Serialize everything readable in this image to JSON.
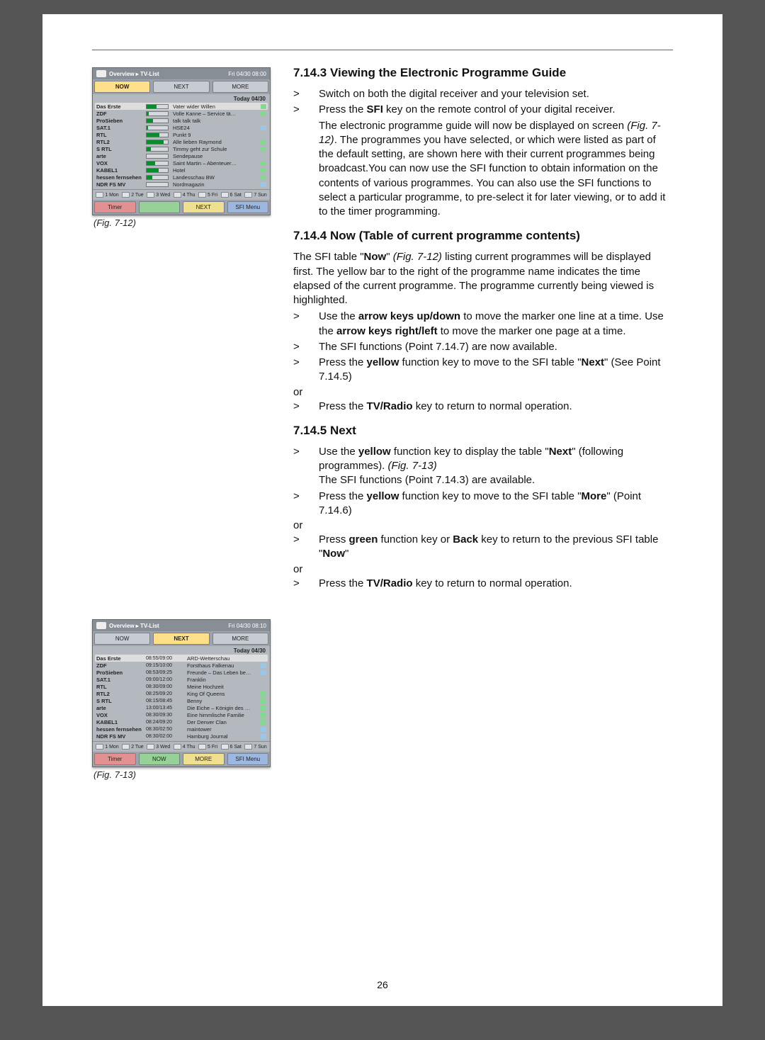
{
  "page_number": "26",
  "sections": {
    "s7143": {
      "heading": "7.14.3 Viewing the Electronic Programme Guide",
      "p1": "Switch on both the digital receiver and your television set.",
      "p2a": "Press the ",
      "p2b": "SFI",
      "p2c": " key on the remote control of your digital receiver.",
      "p3a": "The electronic programme guide will now be displayed on screen ",
      "p3b": "(Fig. 7-12)",
      "p3c": ". The programmes you have selected, or which were listed as part of the default setting, are shown here with their current programmes being broadcast.You can now use the SFI function to obtain information on the contents of various programmes. You can also use the SFI functions to select a particular programme, to pre-select it for later viewing, or to add it to the timer programming."
    },
    "s7144": {
      "heading": "7.14.4 Now (Table of current programme contents)",
      "p1a": "The SFI table \"",
      "p1b": "Now",
      "p1c": "\" ",
      "p1d": "(Fig. 7-12)",
      "p1e": " listing current programmes will be displayed first. The yellow bar to the right of the programme name indicates the time elapsed of the current programme. The programme currently being viewed is highlighted.",
      "b1a": "Use the ",
      "b1b": "arrow keys up/down",
      "b1c": " to move the marker one line at a time. Use the ",
      "b1d": "arrow keys right/left",
      "b1e": " to move the marker one page at a time.",
      "b2": "The SFI functions (Point 7.14.7) are now available.",
      "b3a": "Press the ",
      "b3b": "yellow",
      "b3c": " function key to move to the SFI table \"",
      "b3d": "Next",
      "b3e": "\" (See Point 7.14.5)",
      "or": "or",
      "b4a": "Press the ",
      "b4b": "TV/Radio",
      "b4c": " key to return to normal operation."
    },
    "s7145": {
      "heading": "7.14.5 Next",
      "b1a": "Use the ",
      "b1b": "yellow",
      "b1c": " function key to display the table \"",
      "b1d": "Next",
      "b1e": "\" (following programmes). ",
      "b1f": "(Fig. 7-13)",
      "b1g": "The SFI functions (Point 7.14.3) are available.",
      "b2a": "Press the ",
      "b2b": "yellow",
      "b2c": " function key to move to the SFI table \"",
      "b2d": "More",
      "b2e": "\" (Point 7.14.6)",
      "or": "or",
      "b3a": "Press ",
      "b3b": "green",
      "b3c": " function key or ",
      "b3d": "Back",
      "b3e": " key to return to the previous SFI table \"",
      "b3f": "Now",
      "b3g": "\"",
      "b4a": "Press the ",
      "b4b": "TV/Radio",
      "b4c": " key to return to normal operation."
    }
  },
  "marker": ">",
  "fig12": {
    "caption": "(Fig. 7-12)",
    "breadcrumb": "Overview ▸ TV-List",
    "datetime": "Fri 04/30   08:00",
    "tabs": [
      "NOW",
      "NEXT",
      "MORE"
    ],
    "active_tab": 0,
    "date_label": "Today 04/30",
    "days": [
      "1 Mon",
      "2 Tue",
      "3 Wed",
      "4 Thu",
      "5 Fri",
      "6 Sat",
      "7 Sun"
    ],
    "footer_tabs": [
      "Timer",
      "",
      "NEXT",
      "SFI Menu"
    ],
    "rows": [
      {
        "ch": "Das Erste",
        "fill": 45,
        "prog": "Vater wider Willen",
        "tag": "film",
        "sel": true
      },
      {
        "ch": "ZDF",
        "fill": 10,
        "prog": "Volle Kanne – Service tä…",
        "tag": "film"
      },
      {
        "ch": "ProSieben",
        "fill": 30,
        "prog": "talk talk talk"
      },
      {
        "ch": "SAT.1",
        "fill": 5,
        "prog": "HSE24",
        "tag": "doc"
      },
      {
        "ch": "RTL",
        "fill": 60,
        "prog": "Punkt 9"
      },
      {
        "ch": "RTL2",
        "fill": 80,
        "prog": "Alle lieben Raymond",
        "tag": "film"
      },
      {
        "ch": "S RTL",
        "fill": 20,
        "prog": "Timmy geht zur Schule",
        "tag": "film"
      },
      {
        "ch": "arte",
        "fill": 0,
        "prog": "Sendepause"
      },
      {
        "ch": "VOX",
        "fill": 40,
        "prog": "Saint Martin – Abenteuer…",
        "tag": "film"
      },
      {
        "ch": "KABEL1",
        "fill": 55,
        "prog": "Hotel",
        "tag": "film"
      },
      {
        "ch": "hessen fernsehen",
        "fill": 25,
        "prog": "Landesschau BW",
        "tag": "film"
      },
      {
        "ch": "NDR FS MV",
        "fill": 0,
        "prog": "Nordmagazin",
        "tag": "doc"
      }
    ]
  },
  "fig13": {
    "caption": "(Fig. 7-13)",
    "breadcrumb": "Overview ▸ TV-List",
    "datetime": "Fri 04/30   08:10",
    "tabs": [
      "NOW",
      "NEXT",
      "MORE"
    ],
    "active_tab": 1,
    "date_label": "Today 04/30",
    "days": [
      "1 Mon",
      "2 Tue",
      "3 Wed",
      "4 Thu",
      "5 Fri",
      "6 Sat",
      "7 Sun"
    ],
    "footer_tabs": [
      "Timer",
      "NOW",
      "MORE",
      "SFI Menu"
    ],
    "rows": [
      {
        "ch": "Das Erste",
        "time": "08:55/09:00",
        "prog": "ARD-Wetterschau",
        "sel": true
      },
      {
        "ch": "ZDF",
        "time": "09:15/10:00",
        "prog": "Forsthaus Falkenau",
        "tag": "doc"
      },
      {
        "ch": "ProSieben",
        "time": "08:53/09:25",
        "prog": "Freunde – Das Leben be…",
        "tag": "doc"
      },
      {
        "ch": "SAT.1",
        "time": "09:00/12:00",
        "prog": "Franklin"
      },
      {
        "ch": "RTL",
        "time": "08:30/09:00",
        "prog": "Meine Hochzeit"
      },
      {
        "ch": "RTL2",
        "time": "08:25/09:20",
        "prog": "King Of Queens",
        "tag": "film"
      },
      {
        "ch": "S RTL",
        "time": "08:15/08:45",
        "prog": "Benny",
        "tag": "film"
      },
      {
        "ch": "arte",
        "time": "13:00/13:45",
        "prog": "Die Eiche – Königin des …",
        "tag": "film"
      },
      {
        "ch": "VOX",
        "time": "08:30/09:30",
        "prog": "Eine himmlische Familie",
        "tag": "film"
      },
      {
        "ch": "KABEL1",
        "time": "08:24/09:20",
        "prog": "Der Denver Clan",
        "tag": "film"
      },
      {
        "ch": "hessen fernsehen",
        "time": "08:30/02:50",
        "prog": "maintower",
        "tag": "doc"
      },
      {
        "ch": "NDR FS MV",
        "time": "08:30/02:00",
        "prog": "Hamburg Journal",
        "tag": "doc"
      }
    ]
  }
}
